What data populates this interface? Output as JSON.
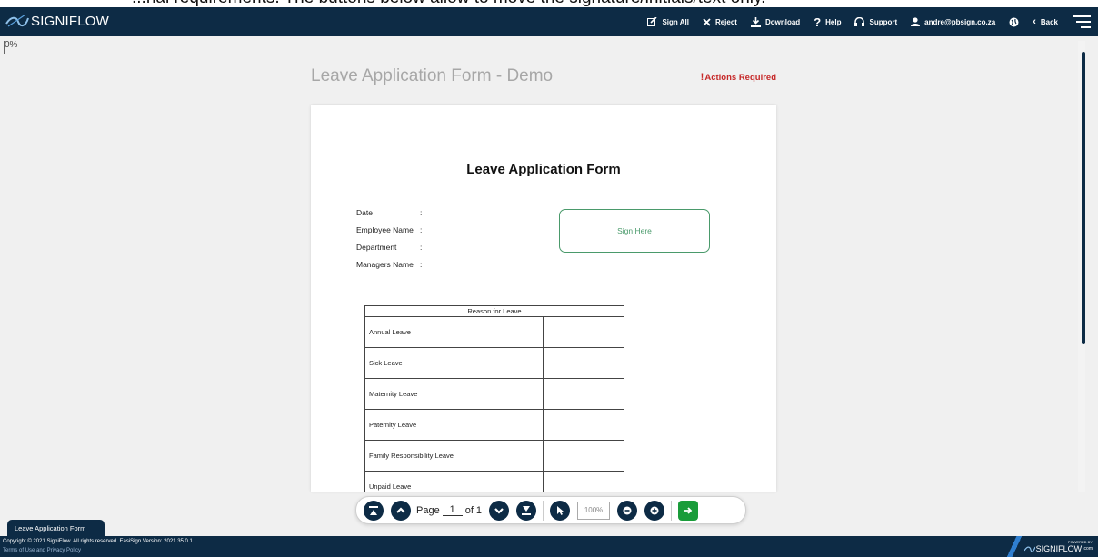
{
  "banner": {
    "text": "...nal requirements. The buttons below allow to move the signature/initials/text only."
  },
  "app": {
    "logo_text": "SIGNIFLOW"
  },
  "nav": {
    "sign_all": "Sign All",
    "reject": "Reject",
    "download": "Download",
    "help": "Help",
    "support": "Support",
    "user": "andre@pbsign.co.za",
    "back": "Back"
  },
  "progress": {
    "text": "0%"
  },
  "document": {
    "title": "Leave Application Form - Demo",
    "actions_required": "Actions Required"
  },
  "form": {
    "title": "Leave Application Form",
    "fields": [
      {
        "label": "Date",
        "sep": ":"
      },
      {
        "label": "Employee Name",
        "sep": ":"
      },
      {
        "label": "Department",
        "sep": ":"
      },
      {
        "label": "Managers Name",
        "sep": ":"
      }
    ],
    "sign_here": "Sign Here",
    "table_header": "Reason for Leave",
    "reasons": [
      "Annual Leave",
      "Sick Leave",
      "Maternity Leave",
      "Paternity Leave",
      "Family Responsibility Leave",
      "Unpaid Leave"
    ]
  },
  "toolbar": {
    "page_label": "Page",
    "page_number": "1",
    "page_of": "of 1",
    "zoom": "100%"
  },
  "doc_tab": {
    "label": "Leave Application Form"
  },
  "footer": {
    "copyright": "Copyright © 2021 SigniFlow. All rights reserved. EasiSign Version: 2021.35.0.1",
    "terms": "Terms of Use and Privacy Policy",
    "powered_by": "POWERED BY",
    "powered_logo": "SIGNIFLOW",
    "powered_suffix": ".com"
  },
  "colors": {
    "navy": "#0d2b45",
    "sign_green": "#4a9a6b",
    "alert_red": "#c62828",
    "go_green": "#1a9c3a"
  }
}
